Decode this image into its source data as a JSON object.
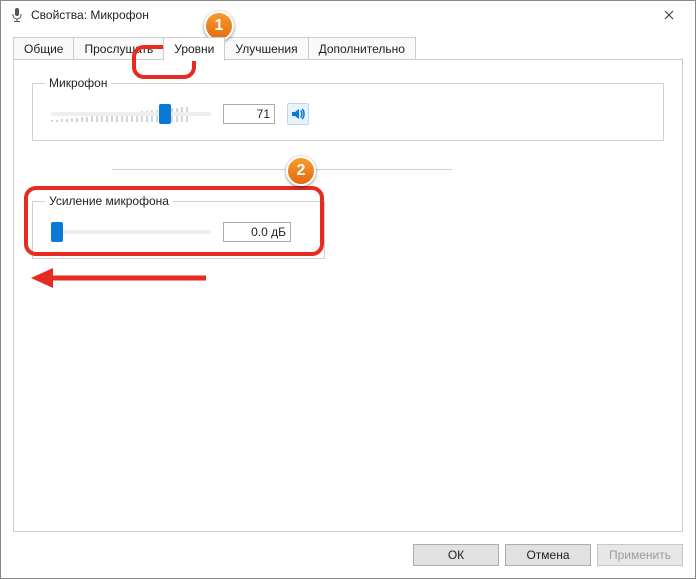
{
  "window": {
    "title": "Свойства: Микрофон"
  },
  "tabs": {
    "general": "Общие",
    "listen": "Прослушать",
    "levels": "Уровни",
    "enhancements": "Улучшения",
    "advanced": "Дополнительно"
  },
  "groups": {
    "mic": {
      "legend": "Микрофон",
      "value": "71",
      "sliderPercent": 71
    },
    "amp": {
      "legend": "Усиление микрофона",
      "value": "0.0 дБ",
      "sliderPercent": 0
    }
  },
  "buttons": {
    "ok": "ОК",
    "cancel": "Отмена",
    "apply": "Применить"
  },
  "annotations": {
    "badge1": "1",
    "badge2": "2"
  }
}
